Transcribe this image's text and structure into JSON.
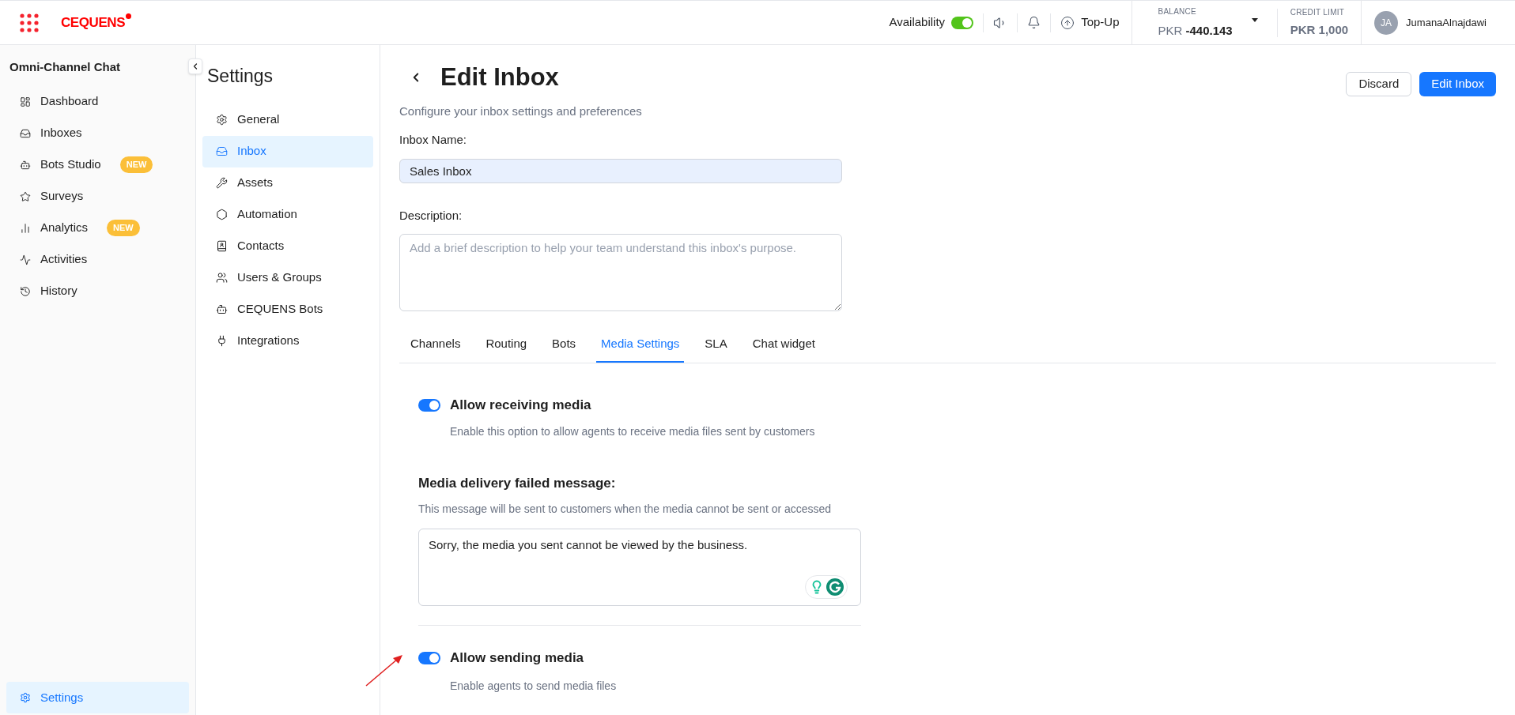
{
  "brand": {
    "name": "CEQUENS"
  },
  "topbar": {
    "availability": {
      "label": "Availability",
      "on": true
    },
    "topup": "Top-Up",
    "balance": {
      "label": "BALANCE",
      "currency": "PKR",
      "amount": "-440.143"
    },
    "credit_limit": {
      "label": "CREDIT LIMIT",
      "value": "PKR 1,000"
    },
    "user": {
      "initials": "JA",
      "name": "JumanaAlnajdawi"
    }
  },
  "sidebar": {
    "title": "Omni-Channel Chat",
    "items": [
      {
        "label": "Dashboard",
        "selected": false
      },
      {
        "label": "Inboxes",
        "selected": false
      },
      {
        "label": "Bots Studio",
        "badge": "NEW",
        "selected": false
      },
      {
        "label": "Surveys",
        "selected": false
      },
      {
        "label": "Analytics",
        "badge": "NEW",
        "selected": false
      },
      {
        "label": "Activities",
        "selected": false
      },
      {
        "label": "History",
        "selected": false
      }
    ],
    "footer": {
      "label": "Settings",
      "selected": true
    }
  },
  "settings_menu": {
    "title": "Settings",
    "items": [
      {
        "label": "General",
        "selected": false
      },
      {
        "label": "Inbox",
        "selected": true
      },
      {
        "label": "Assets",
        "selected": false
      },
      {
        "label": "Automation",
        "selected": false
      },
      {
        "label": "Contacts",
        "selected": false
      },
      {
        "label": "Users & Groups",
        "selected": false
      },
      {
        "label": "CEQUENS Bots",
        "selected": false
      },
      {
        "label": "Integrations",
        "selected": false
      }
    ]
  },
  "page": {
    "title": "Edit Inbox",
    "subtitle": "Configure your inbox settings and preferences",
    "buttons": {
      "discard": "Discard",
      "save": "Edit Inbox"
    },
    "inbox_name": {
      "label": "Inbox Name:",
      "value": "Sales Inbox"
    },
    "description": {
      "label": "Description:",
      "placeholder": "Add a brief description to help your team understand this inbox's purpose."
    },
    "tabs": [
      {
        "label": "Channels",
        "selected": false
      },
      {
        "label": "Routing",
        "selected": false
      },
      {
        "label": "Bots",
        "selected": false
      },
      {
        "label": "Media Settings",
        "selected": true
      },
      {
        "label": "SLA",
        "selected": false
      },
      {
        "label": "Chat widget",
        "selected": false
      }
    ],
    "media": {
      "receiving": {
        "title": "Allow receiving media",
        "description": "Enable this option to allow agents to receive media files sent by customers",
        "on": true
      },
      "failed_message": {
        "label": "Media delivery failed message:",
        "description": "This message will be sent to customers when the media cannot be sent or accessed",
        "value": "Sorry, the media you sent cannot be viewed by the business."
      },
      "sending": {
        "title": "Allow sending media",
        "description": "Enable agents to send media files",
        "on": true
      }
    }
  }
}
